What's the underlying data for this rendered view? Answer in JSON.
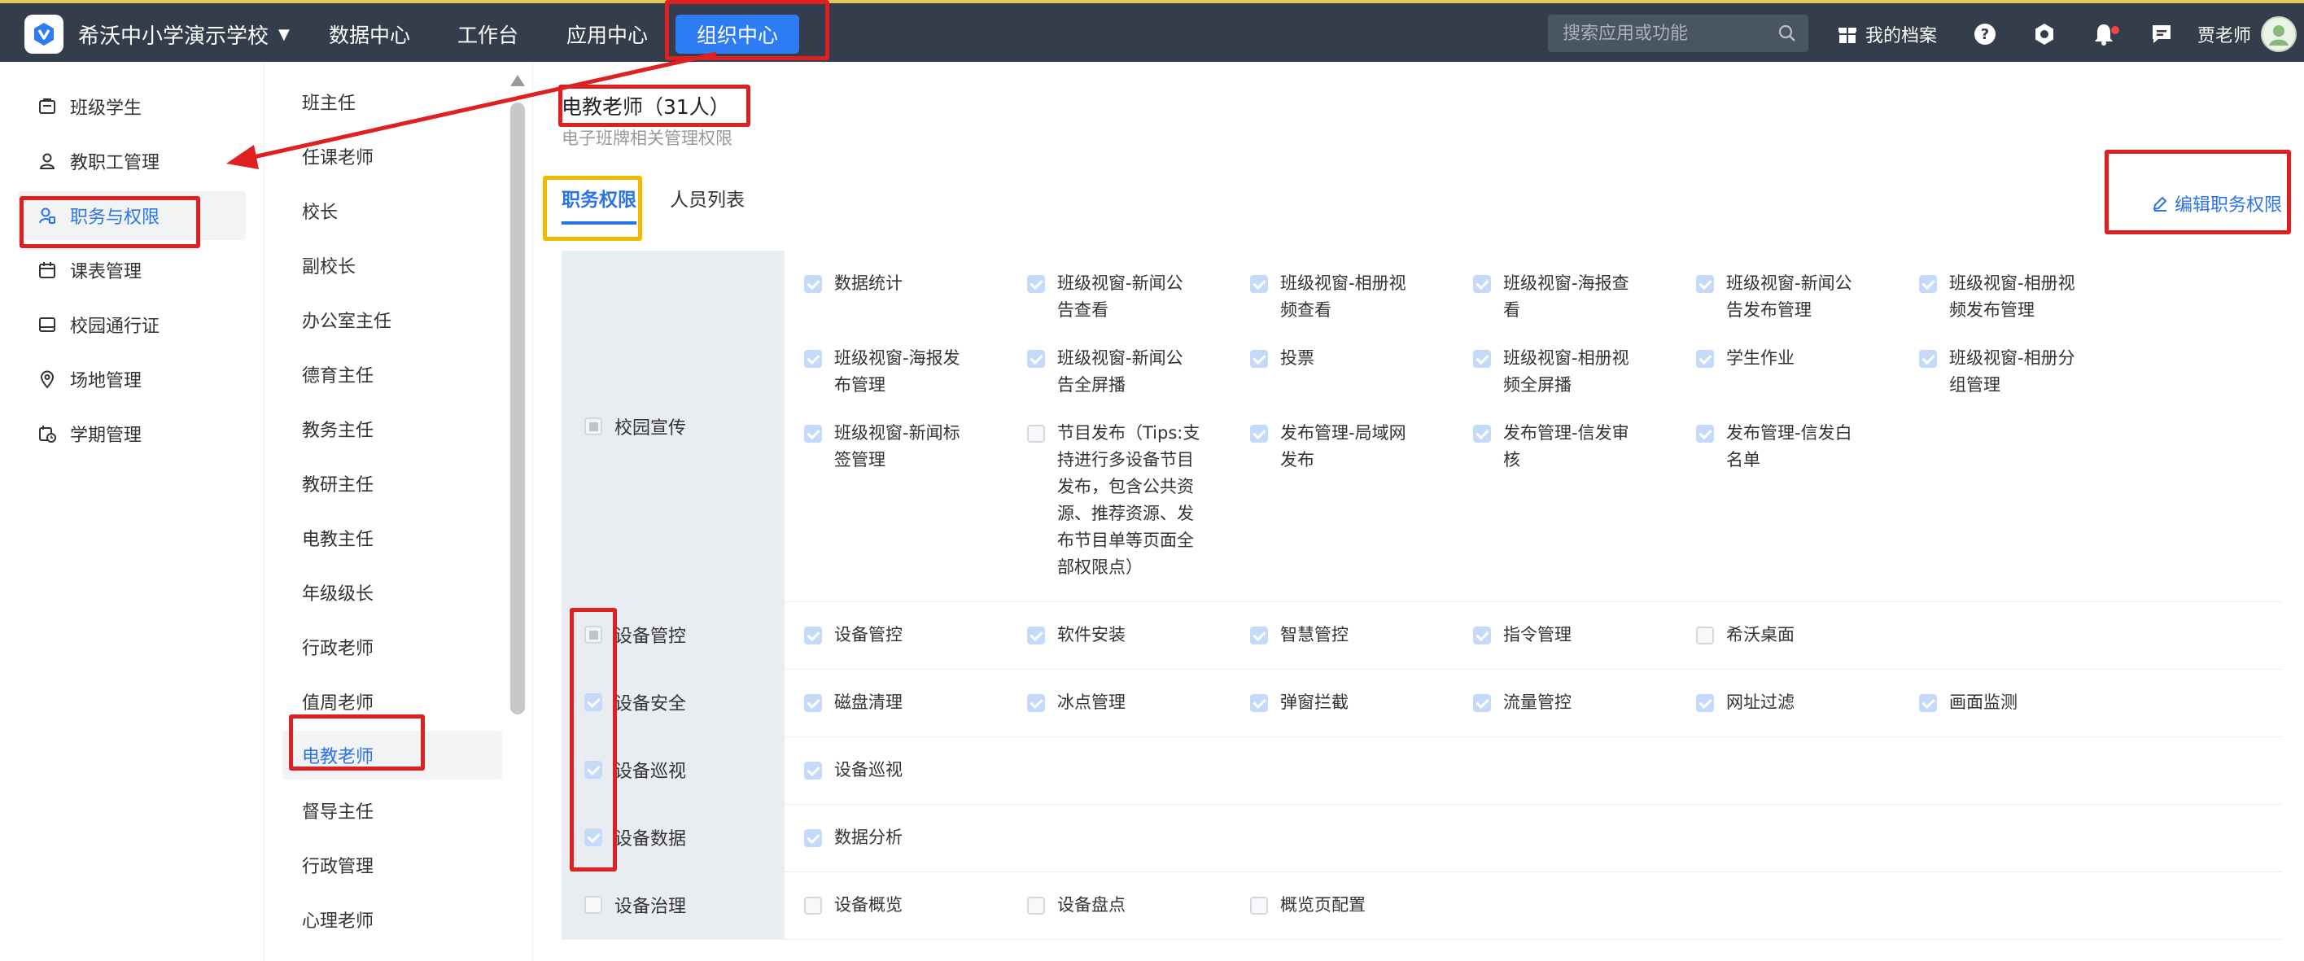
{
  "topbar": {
    "school_name": "希沃中小学演示学校",
    "nav": [
      "数据中心",
      "工作台",
      "应用中心",
      "组织中心"
    ],
    "search_placeholder": "搜索应用或功能",
    "profile_label": "我的档案",
    "user_name": "贾老师"
  },
  "left_menu": [
    {
      "label": "班级学生",
      "icon": "class-icon"
    },
    {
      "label": "教职工管理",
      "icon": "user-icon"
    },
    {
      "label": "职务与权限",
      "icon": "user-shield-icon",
      "active": true
    },
    {
      "label": "课表管理",
      "icon": "calendar-icon"
    },
    {
      "label": "校园通行证",
      "icon": "card-icon"
    },
    {
      "label": "场地管理",
      "icon": "location-icon"
    },
    {
      "label": "学期管理",
      "icon": "calendar-clock-icon"
    }
  ],
  "positions": [
    "班主任",
    "任课老师",
    "校长",
    "副校长",
    "办公室主任",
    "德育主任",
    "教务主任",
    "教研主任",
    "电教主任",
    "年级级长",
    "行政老师",
    "值周老师",
    "电教老师",
    "督导主任",
    "行政管理",
    "心理老师"
  ],
  "active_position": "电教老师",
  "main": {
    "title": "电教老师（31人）",
    "subtitle": "电子班牌相关管理权限",
    "tabs": [
      "职务权限",
      "人员列表"
    ],
    "edit_label": "编辑职务权限"
  },
  "permissions": [
    {
      "category": "校园宣传",
      "state": "partial",
      "items": [
        {
          "label": "数据统计",
          "checked": true
        },
        {
          "label": "班级视窗-新闻公\n告查看",
          "checked": true
        },
        {
          "label": "班级视窗-相册视\n频查看",
          "checked": true
        },
        {
          "label": "班级视窗-海报查\n看",
          "checked": true
        },
        {
          "label": "班级视窗-新闻公\n告发布管理",
          "checked": true
        },
        {
          "label": "班级视窗-相册视\n频发布管理",
          "checked": true
        },
        {
          "label": "班级视窗-海报发\n布管理",
          "checked": true
        },
        {
          "label": "班级视窗-新闻公\n告全屏播",
          "checked": true
        },
        {
          "label": "投票",
          "checked": true
        },
        {
          "label": "班级视窗-相册视\n频全屏播",
          "checked": true
        },
        {
          "label": "学生作业",
          "checked": true
        },
        {
          "label": "班级视窗-相册分\n组管理",
          "checked": true
        },
        {
          "label": "班级视窗-新闻标\n签管理",
          "checked": true
        },
        {
          "label": "节目发布（Tips:支\n持进行多设备节目\n发布，包含公共资\n源、推荐资源、发\n布节目单等页面全\n部权限点）",
          "checked": false
        },
        {
          "label": "发布管理-局域网\n发布",
          "checked": true
        },
        {
          "label": "发布管理-信发审\n核",
          "checked": true
        },
        {
          "label": "发布管理-信发白\n名单",
          "checked": true
        }
      ]
    },
    {
      "category": "设备管控",
      "state": "partial",
      "items": [
        {
          "label": "设备管控",
          "checked": true
        },
        {
          "label": "软件安装",
          "checked": true
        },
        {
          "label": "智慧管控",
          "checked": true
        },
        {
          "label": "指令管理",
          "checked": true
        },
        {
          "label": "希沃桌面",
          "checked": false
        }
      ]
    },
    {
      "category": "设备安全",
      "state": "checked",
      "items": [
        {
          "label": "磁盘清理",
          "checked": true
        },
        {
          "label": "冰点管理",
          "checked": true
        },
        {
          "label": "弹窗拦截",
          "checked": true
        },
        {
          "label": "流量管控",
          "checked": true
        },
        {
          "label": "网址过滤",
          "checked": true
        },
        {
          "label": "画面监测",
          "checked": true
        }
      ]
    },
    {
      "category": "设备巡视",
      "state": "checked",
      "items": [
        {
          "label": "设备巡视",
          "checked": true
        }
      ]
    },
    {
      "category": "设备数据",
      "state": "checked",
      "items": [
        {
          "label": "数据分析",
          "checked": true
        }
      ]
    },
    {
      "category": "设备治理",
      "state": "empty",
      "items": [
        {
          "label": "设备概览",
          "checked": false
        },
        {
          "label": "设备盘点",
          "checked": false
        },
        {
          "label": "概览页配置",
          "checked": false
        }
      ]
    }
  ],
  "colors": {
    "topbar_bg": "#333d4b",
    "accent": "#2a73e8",
    "annotation_red": "#e02020",
    "annotation_yellow": "#f5b800"
  }
}
